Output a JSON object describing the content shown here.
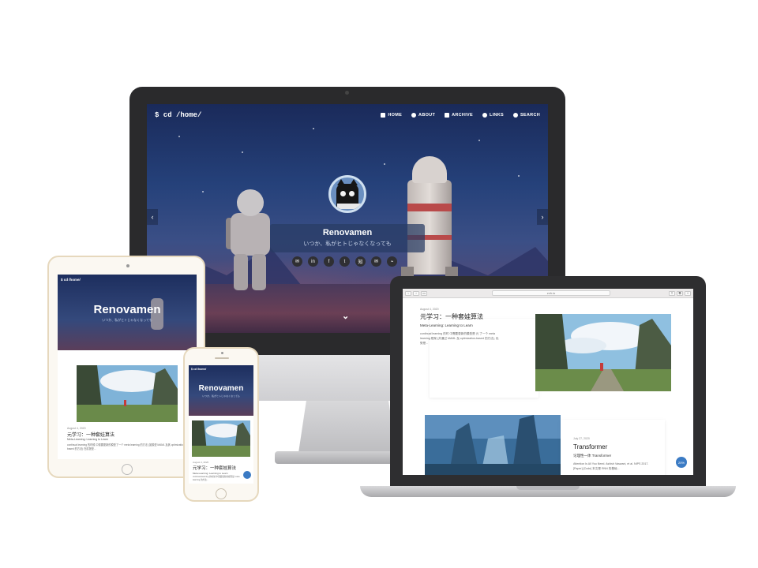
{
  "imac": {
    "brand": "$ cd /home/",
    "menu": [
      {
        "label": "HOME",
        "icon": "home-icon"
      },
      {
        "label": "ABOUT",
        "icon": "paw-icon"
      },
      {
        "label": "ARCHIVE",
        "icon": "archive-icon"
      },
      {
        "label": "LINKS",
        "icon": "link-icon"
      },
      {
        "label": "SEARCH",
        "icon": "search-icon"
      }
    ],
    "site_title": "Renovamen",
    "tagline": "いつか、私がヒトじゃなくなっても",
    "social": [
      {
        "icon": "mail-icon",
        "glyph": "✉"
      },
      {
        "icon": "linkedin-icon",
        "glyph": "in"
      },
      {
        "icon": "facebook-icon",
        "glyph": "f"
      },
      {
        "icon": "twitter-icon",
        "glyph": "t"
      },
      {
        "icon": "zhihu-icon",
        "glyph": "知"
      },
      {
        "icon": "email-icon",
        "glyph": "✉"
      },
      {
        "icon": "rss-icon",
        "glyph": "⌁"
      }
    ],
    "prev_glyph": "‹",
    "next_glyph": "›",
    "scroll_glyph": "⌄"
  },
  "ipad": {
    "brand": "$ cd /home/",
    "site_title": "Renovamen",
    "tagline": "いつか、私がヒトじゃなくなっても",
    "post": {
      "date": "August 4, 2020",
      "title": "元学习：一种套娃算法",
      "subtitle": "Meta-Learning: Learning to Learn",
      "excerpt": "continual learning 的时候 中需要更新的模型了一个 meta learning 的方法 (如模型 MAML 及其 optimization-based 的方法) 在前提是..."
    }
  },
  "iphone": {
    "brand": "$ cd /home/",
    "site_title": "Renovamen",
    "tagline": "いつか、私がヒトじゃなくなっても",
    "post": {
      "date": "August 4, 2020",
      "title": "元学习：一种套娃算法",
      "subtitle": "Meta-Learning: Learning to Learn",
      "excerpt": "continual learning 的时候 中需要更新的模型是 meta learning 的方法..."
    }
  },
  "macbook": {
    "url": "zxh.io",
    "post1": {
      "date": "August 4, 2020",
      "title": "元学习：一种套娃算法",
      "subtitle": "Meta-Learning: Learning to Learn",
      "excerpt": "continual learning 的时 中需要更新的模型是 元 了一个 meta learning 框架 (并通过 MAML 及 optimization-based 的方法), 优势是..."
    },
    "post2": {
      "date": "July 27, 2020",
      "title": "Transformer",
      "subtitle": "论理性一体 Transformer",
      "excerpt": "Attention Is All You Need. Ashish Vaswani, et al. NIPS 2017. [Paper] [Code] 本文是 RNN 的基础..."
    },
    "fab_label": "20%"
  },
  "colors": {
    "accent": "#3b7bc4",
    "night_sky": "#25417a",
    "frame_dark": "#2a2a2c",
    "gold_frame": "#e6d8bd"
  }
}
